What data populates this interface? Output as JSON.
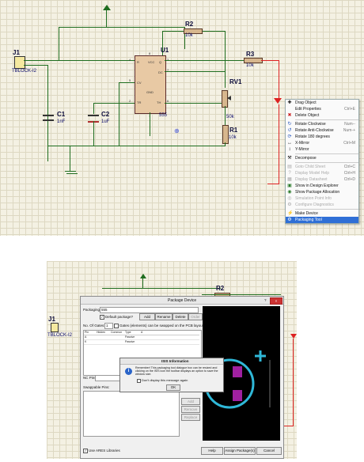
{
  "schematic": {
    "j1": {
      "ref": "J1",
      "part": "TBLOCK-I2"
    },
    "c1": {
      "ref": "C1",
      "value": "1nF"
    },
    "c2": {
      "ref": "C2",
      "value": "1uF"
    },
    "u1": {
      "ref": "U1",
      "part": "555",
      "pins": [
        "R",
        "VCC",
        "Q",
        "DC",
        "CV",
        "GND",
        "TR",
        "TH"
      ],
      "pin_numbers": [
        "4",
        "8",
        "3",
        "7",
        "5",
        "1",
        "2",
        "6"
      ]
    },
    "r2": {
      "ref": "R2",
      "value": "10k"
    },
    "r3": {
      "ref": "R3",
      "value": "10k"
    },
    "rv1": {
      "ref": "RV1",
      "value": "50k"
    },
    "r1": {
      "ref": "R1",
      "value": "10k"
    }
  },
  "context_menu": {
    "items": [
      {
        "label": "Drag Object",
        "shortcut": "",
        "icon": "drag-icon",
        "disabled": false
      },
      {
        "label": "Edit Properties",
        "shortcut": "Ctrl+E",
        "icon": "",
        "disabled": false
      },
      {
        "label": "Delete Object",
        "shortcut": "",
        "icon": "delete-icon",
        "disabled": false
      },
      {
        "label": "Rotate Clockwise",
        "shortcut": "Num--",
        "icon": "rotate-cw-icon",
        "disabled": false
      },
      {
        "label": "Rotate Anti-Clockwise",
        "shortcut": "Num-+",
        "icon": "rotate-ccw-icon",
        "disabled": false
      },
      {
        "label": "Rotate 180 degrees",
        "shortcut": "",
        "icon": "rotate-180-icon",
        "disabled": false
      },
      {
        "label": "X-Mirror",
        "shortcut": "Ctrl+M",
        "icon": "x-mirror-icon",
        "disabled": false
      },
      {
        "label": "Y-Mirror",
        "shortcut": "",
        "icon": "y-mirror-icon",
        "disabled": false
      },
      {
        "label": "Decompose",
        "shortcut": "",
        "icon": "decompose-icon",
        "disabled": false
      },
      {
        "label": "Goto Child Sheet",
        "shortcut": "Ctrl+C",
        "icon": "child-sheet-icon",
        "disabled": true
      },
      {
        "label": "Display Model Help",
        "shortcut": "Ctrl+H",
        "icon": "help-icon",
        "disabled": true
      },
      {
        "label": "Display Datasheet",
        "shortcut": "Ctrl+D",
        "icon": "datasheet-icon",
        "disabled": true
      },
      {
        "label": "Show in Design Explorer",
        "shortcut": "",
        "icon": "explorer-icon",
        "disabled": false
      },
      {
        "label": "Show Package Allocation",
        "shortcut": "",
        "icon": "package-icon",
        "disabled": false
      },
      {
        "label": "Simulation Point Info",
        "shortcut": "",
        "icon": "sim-icon",
        "disabled": true
      },
      {
        "label": "Configure Diagnostics",
        "shortcut": "",
        "icon": "diag-icon",
        "disabled": true
      },
      {
        "label": "Make Device",
        "shortcut": "",
        "icon": "make-device-icon",
        "disabled": false
      },
      {
        "label": "Packaging Tool",
        "shortcut": "",
        "icon": "packaging-icon",
        "disabled": false,
        "selected": true
      }
    ]
  },
  "package_dialog": {
    "title": "Package Device",
    "packagings_label": "Packagings:",
    "packaging_value": "555",
    "default_package_label": "Default package?",
    "add_label": "Add",
    "rename_label": "Rename",
    "delete_label": "Delete",
    "order_label": "Order",
    "no_of_gates_label": "No. Of Gates:",
    "no_of_gates_value": "1",
    "gates_swap_label": "Gates (elements) can be swapped on the PCB layout?",
    "table_headers": [
      "Pin",
      "Hidden",
      "Common",
      "Type",
      "A"
    ],
    "table_rows": [
      {
        "pin": "A",
        "type": "Passive"
      },
      {
        "pin": "K",
        "type": "Passive"
      }
    ],
    "nc_pins_label": "NC Pins:",
    "add_pin_label": "Add Pin",
    "swappable_label": "Swappable Pins:",
    "side_add": "Add",
    "side_remove": "Remove",
    "side_replace": "Replace",
    "use_ares_label": "Use ARES Libraries",
    "help_label": "Help",
    "assign_label": "Assign Package(s)",
    "cancel_label": "Cancel",
    "help_q": "?"
  },
  "info_dialog": {
    "title": "ISIS Information",
    "message": "Remember! This packaging tool dialogue box can be resized and clicking on the ISIS icon the toolbar displays an option to save the window size.",
    "dont_display": "Don't display this message again",
    "ok_label": "OK"
  },
  "colors": {
    "wire": "#1f6d1f",
    "red_wire": "#d22",
    "grid_bg": "#f4f1e3",
    "selection": "#2f6fd6",
    "pcb_bg": "#000000",
    "pad": "#a020a0",
    "silk": "#2fb8d8"
  }
}
